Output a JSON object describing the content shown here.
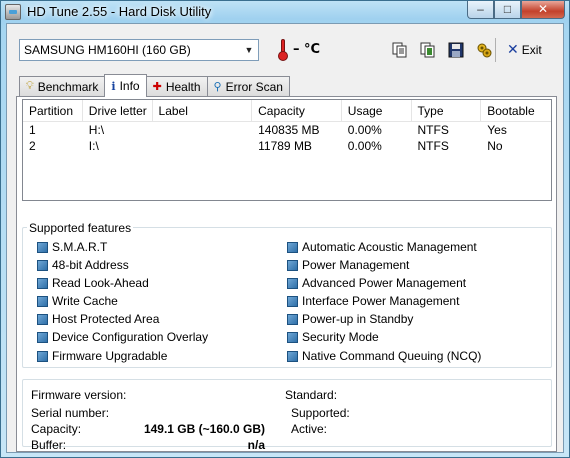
{
  "window": {
    "title": "HD Tune 2.55 - Hard Disk Utility",
    "minimize": "–",
    "maximize": "□",
    "close": "✕"
  },
  "toolbar": {
    "drive_selected": "SAMSUNG HM160HI (160 GB)",
    "temperature": "– °C",
    "exit_label": "Exit",
    "icons": [
      "copy-info-icon",
      "copy-screen-icon",
      "save-icon",
      "options-icon"
    ]
  },
  "tabs": [
    {
      "label": "Benchmark",
      "icon": "bulb-icon"
    },
    {
      "label": "Info",
      "icon": "info-icon",
      "active": true
    },
    {
      "label": "Health",
      "icon": "health-cross-icon"
    },
    {
      "label": "Error Scan",
      "icon": "magnifier-icon"
    }
  ],
  "partition_table": {
    "headers": [
      "Partition",
      "Drive letter",
      "Label",
      "Capacity",
      "Usage",
      "Type",
      "Bootable"
    ],
    "rows": [
      [
        "1",
        "H:\\",
        "",
        "140835 MB",
        "0.00%",
        "NTFS",
        "Yes"
      ],
      [
        "2",
        "I:\\",
        "",
        "11789 MB",
        "0.00%",
        "NTFS",
        "No"
      ]
    ]
  },
  "features": {
    "title": "Supported features",
    "left": [
      "S.M.A.R.T",
      "48-bit Address",
      "Read Look-Ahead",
      "Write Cache",
      "Host Protected Area",
      "Device Configuration Overlay",
      "Firmware Upgradable"
    ],
    "right": [
      "Automatic Acoustic Management",
      "Power Management",
      "Advanced Power Management",
      "Interface Power Management",
      "Power-up in Standby",
      "Security Mode",
      "Native Command Queuing (NCQ)"
    ]
  },
  "info": {
    "firmware_label": "Firmware version:",
    "serial_label": "Serial number:",
    "capacity_label": "Capacity:",
    "capacity_value": "149.1 GB (~160.0 GB)",
    "buffer_label": "Buffer:",
    "buffer_value": "n/a",
    "standard_label": "Standard:",
    "supported_label": "Supported:",
    "active_label": "Active:"
  },
  "colors": {
    "accent": "#2f6fa8",
    "thermometer": "#dd2222"
  }
}
